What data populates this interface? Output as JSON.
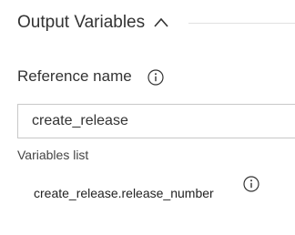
{
  "section": {
    "title": "Output Variables",
    "chevron_icon": "chevron-up-icon"
  },
  "reference": {
    "label": "Reference name",
    "info_icon": "info-icon",
    "value": "create_release"
  },
  "variables": {
    "label": "Variables list",
    "items": [
      {
        "name": "create_release.release_number",
        "info_icon": "info-icon"
      }
    ]
  },
  "colors": {
    "text": "#333333",
    "border": "#c8c8c8",
    "divider": "#e1e1e1"
  }
}
